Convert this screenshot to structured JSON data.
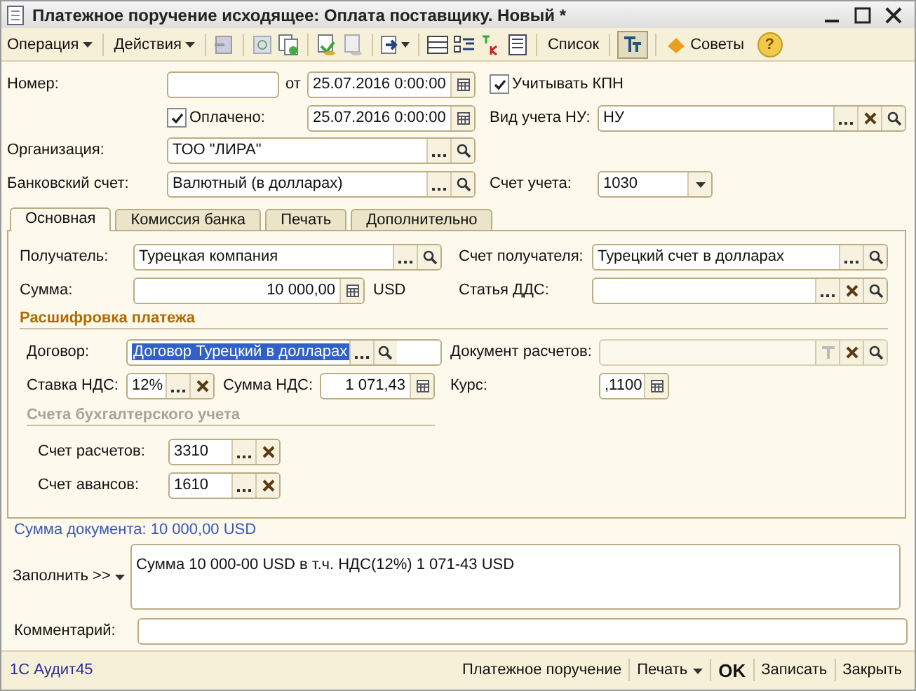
{
  "window": {
    "title": "Платежное поручение исходящее: Оплата поставщику. Новый *"
  },
  "toolbar": {
    "operation": "Операция",
    "actions": "Действия",
    "list": "Список",
    "filter_pressed": true,
    "tips": "Советы",
    "help": "?"
  },
  "header": {
    "number_label": "Номер:",
    "date_label": "от",
    "date": {
      "value": "25.07.2016  0:00:00"
    },
    "kpn": {
      "label": "Учитывать КПН",
      "checked": true
    },
    "paid": {
      "label": "Оплачено:",
      "checked": true
    },
    "paid_date": {
      "value": "25.07.2016  0:00:00"
    },
    "nu": {
      "label": "Вид учета НУ:",
      "value": "НУ"
    },
    "organization": {
      "label": "Организация:",
      "value": "ТОО \"ЛИРА\""
    },
    "bank_account": {
      "label": "Банковский счет:",
      "value": "Валютный (в долларах)"
    },
    "account": {
      "label": "Счет учета:",
      "value": "1030"
    }
  },
  "tabs": [
    {
      "label": "Основная",
      "selected": true
    },
    {
      "label": "Комиссия банка",
      "selected": false
    },
    {
      "label": "Печать",
      "selected": false
    },
    {
      "label": "Дополнительно",
      "selected": false
    }
  ],
  "main": {
    "recipient": {
      "label": "Получатель:",
      "value": "Турецкая компания"
    },
    "recipient_account": {
      "label": "Счет получателя:",
      "value": "Турецкий счет в долларах"
    },
    "amount": {
      "label": "Сумма:",
      "value": "10 000,00"
    },
    "currency": "USD",
    "dds": {
      "label": "Статья ДДС:"
    },
    "section_title": "Расшифровка платежа",
    "contract": {
      "label": "Договор:",
      "value": "Договор Турецкий в долларах",
      "text_selected": true
    },
    "settlement_doc": {
      "label": "Документ расчетов:",
      "disabled": true
    },
    "vat_rate": {
      "label": "Ставка НДС:",
      "value": "12%"
    },
    "vat_amount": {
      "label": "Сумма НДС:",
      "value": "1 071,43"
    },
    "rate": {
      "label": "Курс:",
      "value": ",1100"
    },
    "accounts_title": "Счета бухгалтерского учета",
    "settlement_account": {
      "label": "Счет расчетов:",
      "value": "3310"
    },
    "advance_account": {
      "label": "Счет авансов:",
      "value": "1610"
    }
  },
  "total": "Сумма документа: 10 000,00 USD",
  "fill": {
    "label": "Заполнить >>",
    "text": "Сумма 10 000-00 USD в т.ч. НДС(12%) 1 071-43 USD"
  },
  "comment": {
    "label": "Комментарий:"
  },
  "status": {
    "user": "1С Аудит45",
    "buttons": [
      {
        "label": "Платежное поручение",
        "kind": "plain"
      },
      {
        "label": "Печать",
        "kind": "menu"
      },
      {
        "label": "OK",
        "kind": "default"
      },
      {
        "label": "Записать",
        "kind": "plain"
      },
      {
        "label": "Закрыть",
        "kind": "plain"
      }
    ]
  }
}
